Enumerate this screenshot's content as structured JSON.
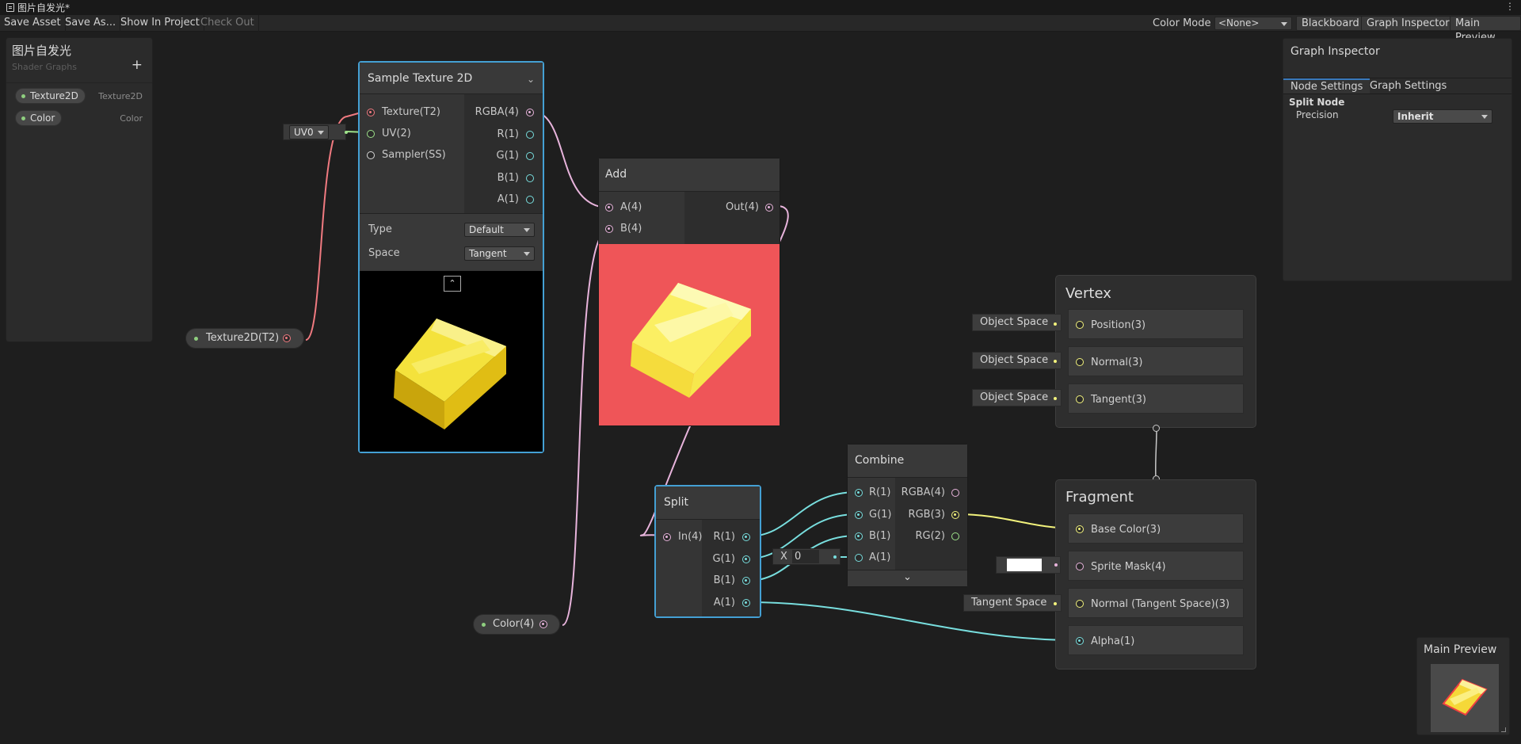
{
  "window": {
    "title": "图片自发光*",
    "menu_icon": "kebab-menu-icon"
  },
  "toolbar": {
    "save_asset": "Save Asset",
    "save_as": "Save As...",
    "show_in_project": "Show In Project",
    "check_out": "Check Out",
    "color_mode_label": "Color Mode",
    "color_mode_value": "<None>",
    "blackboard": "Blackboard",
    "graph_inspector": "Graph Inspector",
    "main_preview": "Main Preview"
  },
  "blackboard": {
    "title": "图片自发光",
    "subtitle": "Shader Graphs",
    "add": "+",
    "properties": [
      {
        "name": "Texture2D",
        "type": "Texture2D"
      },
      {
        "name": "Color",
        "type": "Color"
      }
    ]
  },
  "nodes": {
    "sample_texture": {
      "title": "Sample Texture 2D",
      "inputs": [
        "Texture(T2)",
        "UV(2)",
        "Sampler(SS)"
      ],
      "outputs": [
        "RGBA(4)",
        "R(1)",
        "G(1)",
        "B(1)",
        "A(1)"
      ],
      "type_label": "Type",
      "type_value": "Default",
      "space_label": "Space",
      "space_value": "Tangent",
      "uv_dropdown": "UV0"
    },
    "add": {
      "title": "Add",
      "inputs": [
        "A(4)",
        "B(4)"
      ],
      "outputs": [
        "Out(4)"
      ]
    },
    "split": {
      "title": "Split",
      "inputs": [
        "In(4)"
      ],
      "outputs": [
        "R(1)",
        "G(1)",
        "B(1)",
        "A(1)"
      ]
    },
    "combine": {
      "title": "Combine",
      "inputs": [
        "R(1)",
        "G(1)",
        "B(1)",
        "A(1)"
      ],
      "outputs": [
        "RGBA(4)",
        "RGB(3)",
        "RG(2)"
      ],
      "a_field_label": "X",
      "a_field_value": "0"
    },
    "texture_prop": {
      "label": "Texture2D(T2)"
    },
    "color_prop": {
      "label": "Color(4)"
    }
  },
  "vertex": {
    "title": "Vertex",
    "blocks": [
      {
        "label": "Position(3)",
        "field": "Object Space"
      },
      {
        "label": "Normal(3)",
        "field": "Object Space"
      },
      {
        "label": "Tangent(3)",
        "field": "Object Space"
      }
    ]
  },
  "fragment": {
    "title": "Fragment",
    "blocks": [
      {
        "label": "Base Color(3)",
        "field": ""
      },
      {
        "label": "Sprite Mask(4)",
        "field": ""
      },
      {
        "label": "Normal (Tangent Space)(3)",
        "field": "Tangent Space"
      },
      {
        "label": "Alpha(1)",
        "field": ""
      }
    ]
  },
  "inspector": {
    "title": "Graph Inspector",
    "tabs": [
      "Node Settings",
      "Graph Settings"
    ],
    "section": "Split Node",
    "precision_label": "Precision",
    "precision_value": "Inherit"
  },
  "main_preview": {
    "title": "Main Preview"
  },
  "colors": {
    "accent": "#44a0d4",
    "wire_pink": "#e8b4dc",
    "wire_cyan": "#78dede",
    "wire_yellow": "#f2f27c",
    "wire_red": "#f07a80",
    "add_preview_bg": "#ef5558"
  }
}
